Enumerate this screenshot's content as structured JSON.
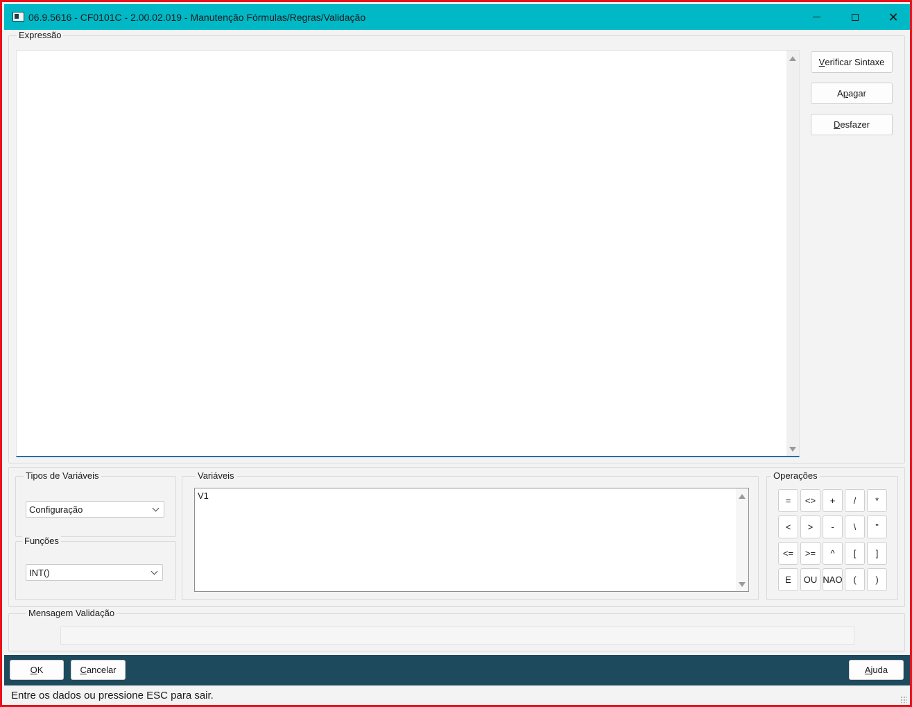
{
  "window": {
    "title": "06.9.5616 - CF0101C - 2.00.02.019 - Manutenção Fórmulas/Regras/Validação",
    "minimize_glyph": "—",
    "close_glyph": "✕"
  },
  "expressao": {
    "legend": "Expressão",
    "value": "",
    "buttons": {
      "verificar": {
        "first": "V",
        "rest": "erificar Sintaxe"
      },
      "apagar": {
        "pre": "A",
        "ul": "p",
        "rest": "agar"
      },
      "desfazer": {
        "first": "D",
        "rest": "esfazer"
      }
    }
  },
  "tipos_variaveis": {
    "legend": "Tipos de Variáveis",
    "selected": "Configuração"
  },
  "funcoes": {
    "legend": "Funções",
    "selected": "INT()"
  },
  "variaveis": {
    "legend": "Variáveis",
    "items": [
      "V1"
    ]
  },
  "operacoes": {
    "legend": "Operações",
    "rows": [
      [
        "=",
        "<>",
        "+",
        "/",
        "*"
      ],
      [
        "<",
        ">",
        "-",
        "\\",
        "\""
      ],
      [
        "<=",
        ">=",
        "^",
        "[",
        "]"
      ],
      [
        "E",
        "OU",
        "NAO",
        "(",
        ")"
      ]
    ]
  },
  "mensagem": {
    "legend": "Mensagem Validação",
    "value": ""
  },
  "footer": {
    "ok": {
      "first": "O",
      "rest": "K"
    },
    "cancelar": {
      "first": "C",
      "rest": "ancelar"
    },
    "ajuda": {
      "first": "A",
      "rest": "juda"
    }
  },
  "status": {
    "text": "Entre os dados ou pressione ESC para sair."
  },
  "colors": {
    "titlebar": "#00b8c6",
    "buttonbar": "#1e4a5d",
    "window_border": "#e8121b",
    "focus_line": "#1f6fb2"
  }
}
